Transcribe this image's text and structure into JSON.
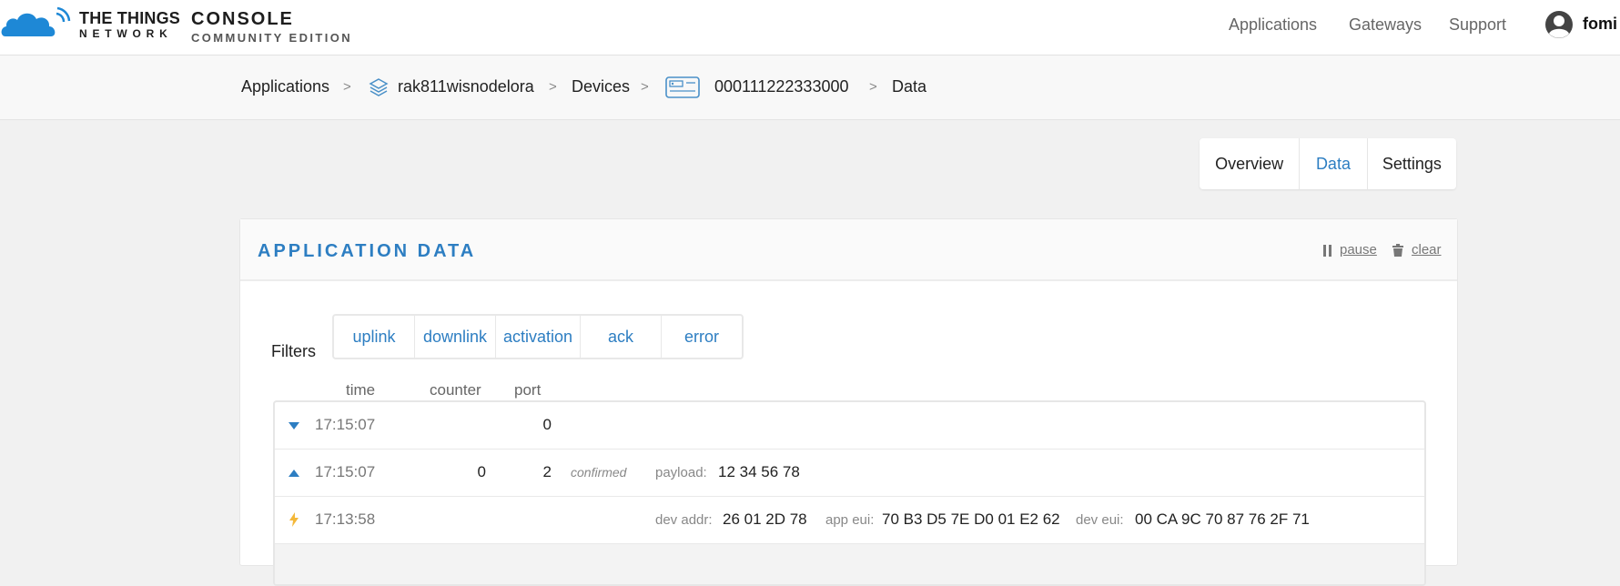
{
  "header": {
    "brand": {
      "line1": "THE THINGS",
      "line2": "NETWORK"
    },
    "console": {
      "line1": "CONSOLE",
      "line2": "COMMUNITY EDITION"
    },
    "nav": [
      "Applications",
      "Gateways",
      "Support"
    ],
    "user": "fomi",
    "icons": {
      "logo": "cloud-logo-icon",
      "user": "user-avatar-icon"
    }
  },
  "breadcrumb": {
    "items": [
      "Applications",
      "rak811wisnodelora",
      "Devices",
      "000111222333000",
      "Data"
    ],
    "separator": ">",
    "icons": {
      "application": "layers-icon",
      "device": "device-icon"
    }
  },
  "tabs": {
    "items": [
      "Overview",
      "Data",
      "Settings"
    ],
    "active": "Data"
  },
  "panel": {
    "title": "APPLICATION DATA",
    "pause": "pause",
    "clear": "clear",
    "filters_label": "Filters",
    "filters": [
      "uplink",
      "downlink",
      "activation",
      "ack",
      "error"
    ],
    "columns": [
      "time",
      "counter",
      "port"
    ],
    "rows": [
      {
        "icon": "downlink-arrow-icon",
        "time": "17:15:07",
        "counter": "",
        "port": "0"
      },
      {
        "icon": "uplink-arrow-icon",
        "time": "17:15:07",
        "counter": "0",
        "port": "2",
        "tag": "confirmed",
        "payload_label": "payload:",
        "payload": "12 34 56 78"
      },
      {
        "icon": "activation-bolt-icon",
        "time": "17:13:58",
        "dev_addr_label": "dev addr:",
        "dev_addr": "26 01 2D 78",
        "app_eui_label": "app eui:",
        "app_eui": "70 B3 D5 7E D0 01 E2 62",
        "dev_eui_label": "dev eui:",
        "dev_eui": "00 CA 9C 70 87 76 2F 71"
      }
    ]
  },
  "colors": {
    "accent": "#2d7ec2",
    "bolt": "#f4b83a",
    "background": "#f1f1f1"
  }
}
